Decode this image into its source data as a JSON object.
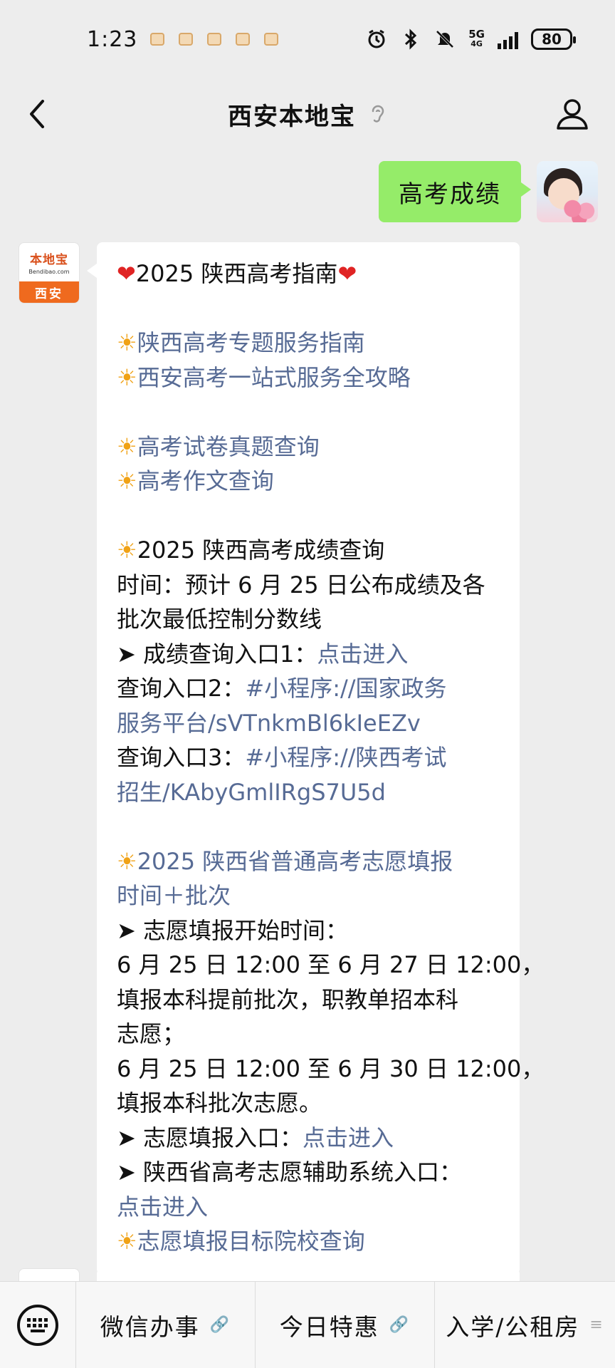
{
  "status_bar": {
    "time": "1:23",
    "network": "5G",
    "battery": "80"
  },
  "header": {
    "title": "西安本地宝"
  },
  "messages": {
    "user_message": "高考成绩",
    "bot_avatar": {
      "logo_text": "本地宝",
      "logo_url": "Bendibao.com",
      "city": "西安"
    },
    "bot_reply": {
      "title": "2025 陕西高考指南",
      "link_1": "陕西高考专题服务指南",
      "link_2": "西安高考一站式服务全攻略",
      "link_3": "高考试卷真题查询",
      "link_4": "高考作文查询",
      "section_1_title": "2025 陕西高考成绩查询",
      "time_line_1": "时间：预计 6 月 25 日公布成绩及各",
      "time_line_2": "批次最低控制分数线",
      "entry_1_label": "➤ 成绩查询入口1：",
      "entry_1_link": "点击进入",
      "entry_2_label": "查询入口2：",
      "entry_2_link_a": "#小程序://国家政务",
      "entry_2_link_b": "服务平台/sVTnkmBl6kIeEZv",
      "entry_3_label": "查询入口3：",
      "entry_3_link_a": "#小程序://陕西考试",
      "entry_3_link_b": "招生/KAbyGmlIRgS7U5d",
      "section_2_title_a": "2025 陕西省普通高考志愿填报",
      "section_2_title_b": "时间＋批次",
      "start_time_label": "➤ 志愿填报开始时间：",
      "period_1_a": "6 月 25 日 12:00 至 6 月 27 日 12:00，",
      "period_1_b": "填报本科提前批次，职教单招本科",
      "period_1_c": "志愿；",
      "period_2_a": "6 月 25 日 12:00 至 6 月 30 日 12:00，",
      "period_2_b": "填报本科批次志愿。",
      "entry_4_label": "➤ 志愿填报入口：",
      "entry_4_link": "点击进入",
      "entry_5_label": "➤ 陕西省高考志愿辅助系统入口：",
      "entry_5_link": "点击进入",
      "link_last": "志愿填报目标院校查询"
    }
  },
  "bottom_menu": {
    "items": [
      "微信办事",
      "今日特惠",
      "入学/公租房"
    ]
  },
  "colors": {
    "user_bubble": "#95ec69",
    "link": "#576b95",
    "brand_orange": "#ef6a1e",
    "background": "#ededed"
  }
}
